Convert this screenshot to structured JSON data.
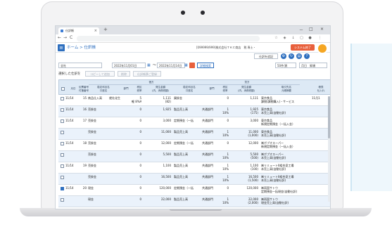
{
  "browser": {
    "tab_title": "仕訳帳",
    "new_tab": "+",
    "minimize": "－",
    "maximize": "□",
    "close": "×",
    "back": "←",
    "forward": "→",
    "reload": "C",
    "home": "⌂"
  },
  "app": {
    "breadcrumb": "ホーム > 仕訳帳",
    "company": "[099999/999]株式会社ＴＫＣ商店　税 専士・",
    "system_button": "システム終了",
    "dept_button": "仕訳を追記",
    "menu_icon": "≡"
  },
  "filters": {
    "scope": "全社",
    "date_from": "2022年11月01日",
    "date_sep": "〜",
    "date_to": "2022年11月14日",
    "detail_search": "詳細検索",
    "per_page": "50件/頁",
    "sort": "月日　昇順"
  },
  "actions": {
    "label": "選択した仕訳を",
    "copy": "コピーして追加",
    "delete": "削除",
    "print": "仕訳帳票ご登録"
  },
  "table": {
    "group_debit": "借方",
    "group_credit": "貸方",
    "headers": {
      "month_day": "月日",
      "voucher": "伝票番号\n付箋番号",
      "debit_account": "勘定科目名\n口座名",
      "debit_dept": "部門",
      "debit_tax": "税区\n税率",
      "debit_amount": "発生金額\n(内、消費税額)",
      "credit_account": "勘定科目名\n口座名",
      "credit_dept": "部門",
      "credit_tax": "税区\n税率",
      "credit_amount": "発生金額\n(内、消費税額)",
      "partner": "取引先名\n元帳摘要",
      "input": "帳表\n仕入れ"
    },
    "rows": [
      {
        "checked": false,
        "date": "11/14",
        "no": "15",
        "d_acc": "商品仕入高",
        "d_dept": "就社化生",
        "d_tax": "5\n軽 8%A",
        "d_amt": "1,111\n(82)",
        "c_acc": "買掛金",
        "c_dept": "",
        "c_tax": "0",
        "c_amt": "1,111",
        "partner": "東京食品\n課税(課税購入)・サービス",
        "extra": "11月1"
      },
      {
        "checked": false,
        "date": "11/14",
        "no": "16",
        "d_acc": "売掛金",
        "d_dept": "",
        "d_tax": "0",
        "d_amt": "1,925",
        "c_acc": "製品売上高",
        "c_dept": "共通部門",
        "c_tax": "1\n10%",
        "c_amt": "1,925\n(175)",
        "partner": "東京食品\n本売上高(自動仕訳)",
        "extra": ""
      },
      {
        "checked": false,
        "date": "11/14",
        "no": "17",
        "d_acc": "売掛金",
        "d_dept": "",
        "d_tax": "0",
        "d_amt": "3,000",
        "c_acc": "定期預金（一括",
        "c_dept": "共通部門",
        "c_tax": "0",
        "c_amt": "3,000",
        "partner": "東京食品\n新規定期預金（一括入金）",
        "extra": ""
      },
      {
        "checked": false,
        "date": "",
        "no": "",
        "d_acc": "売掛金",
        "d_dept": "",
        "d_tax": "0",
        "d_amt": "11,000",
        "c_acc": "製品売上高",
        "c_dept": "共通部門",
        "c_tax": "1\n10%",
        "c_amt": "11,000\n(1,000)",
        "partner": "東京食品\n本売上高(自動仕訳)",
        "extra": ""
      },
      {
        "checked": false,
        "date": "11/14",
        "no": "18",
        "d_acc": "売掛金",
        "d_dept": "",
        "d_tax": "0",
        "d_amt": "12,000",
        "c_acc": "定期預金（一括",
        "c_dept": "共通部門",
        "c_tax": "0",
        "c_amt": "12,000",
        "partner": "㈱ポプオスーパー\n新規定期預金（一括入金）",
        "extra": ""
      },
      {
        "checked": false,
        "date": "",
        "no": "",
        "d_acc": "売掛金",
        "d_dept": "",
        "d_tax": "0",
        "d_amt": "5,500",
        "c_acc": "製品売上高",
        "c_dept": "共通部門",
        "c_tax": "1\n10%",
        "c_amt": "5,500\n(500)",
        "partner": "㈱ポプオスーパー\n本売上高(自動仕訳)",
        "extra": ""
      },
      {
        "checked": false,
        "date": "11/14",
        "no": "19",
        "d_acc": "売掛金",
        "d_dept": "",
        "d_tax": "0",
        "d_amt": "1,100",
        "c_acc": "製品売上高",
        "c_dept": "共通部門",
        "c_tax": "1\n10%",
        "c_amt": "1,100\n(100)",
        "partner": "㈱リミュートII組合見工場\n本売上高(自動仕訳)",
        "extra": ""
      },
      {
        "checked": false,
        "date": "",
        "no": "",
        "d_acc": "売掛金",
        "d_dept": "",
        "d_tax": "0",
        "d_amt": "16,500",
        "c_acc": "製品売上高",
        "c_dept": "共通部門",
        "c_tax": "1\n10%",
        "c_amt": "16,500\n(1,500)",
        "partner": "㈱リミュートII組合見工場\n本売上高(自動仕訳)",
        "extra": ""
      },
      {
        "checked": true,
        "date": "11/14",
        "no": "20",
        "d_acc": "現金",
        "d_dept": "",
        "d_tax": "0",
        "d_amt": "120,000",
        "c_acc": "定期預金（一括",
        "c_dept": "共通部門",
        "c_tax": "0",
        "c_amt": "120,000",
        "partner": "㈱両国サトウ\n定期預金一括現金(自動仕訳)",
        "extra": ""
      },
      {
        "checked": false,
        "date": "",
        "no": "",
        "d_acc": "現金",
        "d_dept": "",
        "d_tax": "0",
        "d_amt": "22,000",
        "c_acc": "製品売上高",
        "c_dept": "共通部門",
        "c_tax": "1\n10%",
        "c_amt": "22,000\n(2,000)",
        "partner": "㈱両国サトウ\n現金売上高(自動仕訳)",
        "extra": ""
      }
    ]
  }
}
